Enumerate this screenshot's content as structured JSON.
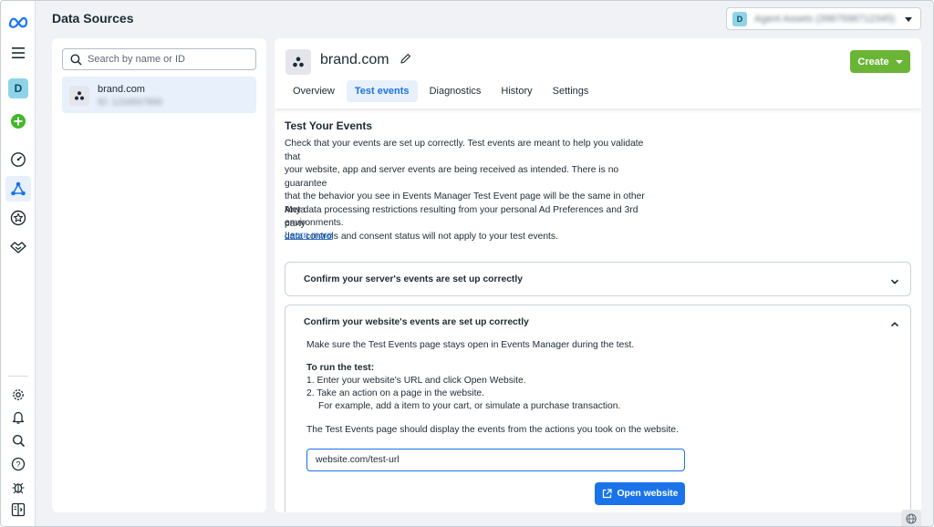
{
  "header": {
    "title": "Data Sources"
  },
  "account": {
    "avatar_letter": "D",
    "name": "Agent Assets (3987598712345)"
  },
  "rail": {
    "avatar_letter": "D"
  },
  "left": {
    "search_placeholder": "Search by name or ID",
    "items": [
      {
        "name": "brand.com",
        "id": "ID: 1234567890"
      }
    ]
  },
  "main": {
    "title": "brand.com",
    "create_label": "Create",
    "tabs": [
      "Overview",
      "Test events",
      "Diagnostics",
      "History",
      "Settings"
    ],
    "active_tab": "Test events"
  },
  "test_events": {
    "title": "Test Your Events",
    "para1": [
      "Check that your events are set up correctly. Test events are meant to help you validate that",
      "your website, app and server events are being received as intended. There is no guarantee",
      "that the behavior you see in Events Manager Test Event page will be the same in other Meta",
      "environments."
    ],
    "para2": [
      "Any data processing restrictions resulting from your personal Ad Preferences and 3rd party",
      "data controls and consent status will not apply to your test events."
    ],
    "learn_more": "Learn more",
    "server_section": {
      "title": "Confirm your server's events are set up correctly"
    },
    "website_section": {
      "title": "Confirm your website's events are set up correctly",
      "intro": "Make sure the Test Events page stays open in Events Manager during the test.",
      "how_title": "To run the test:",
      "step1": "1.  Enter your website's URL and click Open Website.",
      "step2": "2.  Take an action on a page in the website.",
      "step2_sub": "For example, add a item to your cart, or simulate a purchase transaction.",
      "outro": "The Test Events page should display the events from the actions you took on the website.",
      "url_value": "website.com/test-url",
      "open_label": "Open website"
    }
  },
  "colors": {
    "accent": "#1a73e8",
    "create": "#6bb536",
    "active_bg": "#e7f0fb"
  }
}
